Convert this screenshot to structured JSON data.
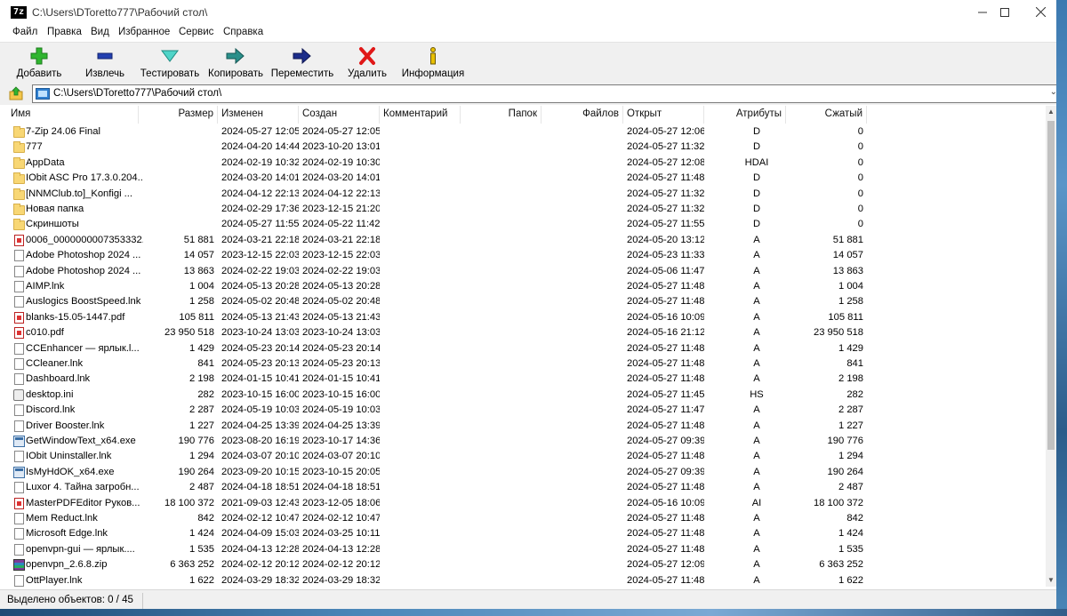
{
  "window": {
    "title": "C:\\Users\\DToretto777\\Рабочий стол\\",
    "app_icon_text": "7z"
  },
  "menu": [
    "Файл",
    "Правка",
    "Вид",
    "Избранное",
    "Сервис",
    "Справка"
  ],
  "toolbar": {
    "add": "Добавить",
    "extract": "Извлечь",
    "test": "Тестировать",
    "copy": "Копировать",
    "move": "Переместить",
    "delete": "Удалить",
    "info": "Информация"
  },
  "address": {
    "path": "C:\\Users\\DToretto777\\Рабочий стол\\"
  },
  "columns": {
    "name": "Имя",
    "size": "Размер",
    "modified": "Изменен",
    "created": "Создан",
    "comment": "Комментарий",
    "folders": "Папок",
    "files": "Файлов",
    "opened": "Открыт",
    "attributes": "Атрибуты",
    "packed": "Сжатый"
  },
  "rows": [
    {
      "icon": "folder",
      "name": "7-Zip 24.06 Final",
      "size": "",
      "modified": "2024-05-27 12:05",
      "created": "2024-05-27 12:05",
      "opened": "2024-05-27 12:06",
      "attr": "D",
      "packed": "0"
    },
    {
      "icon": "folder",
      "name": "777",
      "size": "",
      "modified": "2024-04-20 14:44",
      "created": "2023-10-20 13:01",
      "opened": "2024-05-27 11:32",
      "attr": "D",
      "packed": "0"
    },
    {
      "icon": "folder",
      "name": "AppData",
      "size": "",
      "modified": "2024-02-19 10:32",
      "created": "2024-02-19 10:30",
      "opened": "2024-05-27 12:08",
      "attr": "HDAI",
      "packed": "0"
    },
    {
      "icon": "folder",
      "name": "IObit ASC Pro 17.3.0.204...",
      "size": "",
      "modified": "2024-03-20 14:01",
      "created": "2024-03-20 14:01",
      "opened": "2024-05-27 11:48",
      "attr": "D",
      "packed": "0"
    },
    {
      "icon": "folder",
      "name": "[NNMClub.to]_Konfigi ...",
      "size": "",
      "modified": "2024-04-12 22:13",
      "created": "2024-04-12 22:13",
      "opened": "2024-05-27 11:32",
      "attr": "D",
      "packed": "0"
    },
    {
      "icon": "folder",
      "name": "Новая папка",
      "size": "",
      "modified": "2024-02-29 17:36",
      "created": "2023-12-15 21:20",
      "opened": "2024-05-27 11:32",
      "attr": "D",
      "packed": "0"
    },
    {
      "icon": "folder",
      "name": "Скриншоты",
      "size": "",
      "modified": "2024-05-27 11:55",
      "created": "2024-05-22 11:42",
      "opened": "2024-05-27 11:55",
      "attr": "D",
      "packed": "0"
    },
    {
      "icon": "pdf",
      "name": "0006_0000000007353332...",
      "size": "51 881",
      "modified": "2024-03-21 22:18",
      "created": "2024-03-21 22:18",
      "opened": "2024-05-20 13:12",
      "attr": "A",
      "packed": "51 881"
    },
    {
      "icon": "file",
      "name": "Adobe Photoshop 2024 ...",
      "size": "14 057",
      "modified": "2023-12-15 22:03",
      "created": "2023-12-15 22:03",
      "opened": "2024-05-23 11:33",
      "attr": "A",
      "packed": "14 057"
    },
    {
      "icon": "file",
      "name": "Adobe Photoshop 2024 ...",
      "size": "13 863",
      "modified": "2024-02-22 19:03",
      "created": "2024-02-22 19:03",
      "opened": "2024-05-06 11:47",
      "attr": "A",
      "packed": "13 863"
    },
    {
      "icon": "file",
      "name": "AIMP.lnk",
      "size": "1 004",
      "modified": "2024-05-13 20:28",
      "created": "2024-05-13 20:28",
      "opened": "2024-05-27 11:48",
      "attr": "A",
      "packed": "1 004"
    },
    {
      "icon": "file",
      "name": "Auslogics BoostSpeed.lnk",
      "size": "1 258",
      "modified": "2024-05-02 20:48",
      "created": "2024-05-02 20:48",
      "opened": "2024-05-27 11:48",
      "attr": "A",
      "packed": "1 258"
    },
    {
      "icon": "pdf",
      "name": "blanks-15.05-1447.pdf",
      "size": "105 811",
      "modified": "2024-05-13 21:43",
      "created": "2024-05-13 21:43",
      "opened": "2024-05-16 10:09",
      "attr": "A",
      "packed": "105 811"
    },
    {
      "icon": "pdf",
      "name": "c010.pdf",
      "size": "23 950 518",
      "modified": "2023-10-24 13:03",
      "created": "2023-10-24 13:03",
      "opened": "2024-05-16 21:12",
      "attr": "A",
      "packed": "23 950 518"
    },
    {
      "icon": "file",
      "name": "CCEnhancer — ярлык.l...",
      "size": "1 429",
      "modified": "2024-05-23 20:14",
      "created": "2024-05-23 20:14",
      "opened": "2024-05-27 11:48",
      "attr": "A",
      "packed": "1 429"
    },
    {
      "icon": "file",
      "name": "CCleaner.lnk",
      "size": "841",
      "modified": "2024-05-23 20:13",
      "created": "2024-05-23 20:13",
      "opened": "2024-05-27 11:48",
      "attr": "A",
      "packed": "841"
    },
    {
      "icon": "file",
      "name": "Dashboard.lnk",
      "size": "2 198",
      "modified": "2024-01-15 10:41",
      "created": "2024-01-15 10:41",
      "opened": "2024-05-27 11:48",
      "attr": "A",
      "packed": "2 198"
    },
    {
      "icon": "ini",
      "name": "desktop.ini",
      "size": "282",
      "modified": "2023-10-15 16:00",
      "created": "2023-10-15 16:00",
      "opened": "2024-05-27 11:45",
      "attr": "HS",
      "packed": "282"
    },
    {
      "icon": "file",
      "name": "Discord.lnk",
      "size": "2 287",
      "modified": "2024-05-19 10:03",
      "created": "2024-05-19 10:03",
      "opened": "2024-05-27 11:47",
      "attr": "A",
      "packed": "2 287"
    },
    {
      "icon": "file",
      "name": "Driver Booster.lnk",
      "size": "1 227",
      "modified": "2024-04-25 13:39",
      "created": "2024-04-25 13:39",
      "opened": "2024-05-27 11:48",
      "attr": "A",
      "packed": "1 227"
    },
    {
      "icon": "exe",
      "name": "GetWindowText_x64.exe",
      "size": "190 776",
      "modified": "2023-08-20 16:19",
      "created": "2023-10-17 14:36",
      "opened": "2024-05-27 09:39",
      "attr": "A",
      "packed": "190 776"
    },
    {
      "icon": "file",
      "name": "IObit Uninstaller.lnk",
      "size": "1 294",
      "modified": "2024-03-07 20:10",
      "created": "2024-03-07 20:10",
      "opened": "2024-05-27 11:48",
      "attr": "A",
      "packed": "1 294"
    },
    {
      "icon": "exe",
      "name": "IsMyHdOK_x64.exe",
      "size": "190 264",
      "modified": "2023-09-20 10:15",
      "created": "2023-10-15 20:05",
      "opened": "2024-05-27 09:39",
      "attr": "A",
      "packed": "190 264"
    },
    {
      "icon": "file",
      "name": "Luxor 4. Тайна загробн...",
      "size": "2 487",
      "modified": "2024-04-18 18:51",
      "created": "2024-04-18 18:51",
      "opened": "2024-05-27 11:48",
      "attr": "A",
      "packed": "2 487"
    },
    {
      "icon": "pdf",
      "name": "MasterPDFEditor Руков...",
      "size": "18 100 372",
      "modified": "2021-09-03 12:43",
      "created": "2023-12-05 18:06",
      "opened": "2024-05-16 10:09",
      "attr": "AI",
      "packed": "18 100 372"
    },
    {
      "icon": "file",
      "name": "Mem Reduct.lnk",
      "size": "842",
      "modified": "2024-02-12 10:47",
      "created": "2024-02-12 10:47",
      "opened": "2024-05-27 11:48",
      "attr": "A",
      "packed": "842"
    },
    {
      "icon": "file",
      "name": "Microsoft Edge.lnk",
      "size": "1 424",
      "modified": "2024-04-09 15:03",
      "created": "2024-03-25 10:11",
      "opened": "2024-05-27 11:48",
      "attr": "A",
      "packed": "1 424"
    },
    {
      "icon": "file",
      "name": "openvpn-gui — ярлык....",
      "size": "1 535",
      "modified": "2024-04-13 12:28",
      "created": "2024-04-13 12:28",
      "opened": "2024-05-27 11:48",
      "attr": "A",
      "packed": "1 535"
    },
    {
      "icon": "zip",
      "name": "openvpn_2.6.8.zip",
      "size": "6 363 252",
      "modified": "2024-02-12 20:12",
      "created": "2024-02-12 20:12",
      "opened": "2024-05-27 12:09",
      "attr": "A",
      "packed": "6 363 252"
    },
    {
      "icon": "file",
      "name": "OttPlayer.lnk",
      "size": "1 622",
      "modified": "2024-03-29 18:32",
      "created": "2024-03-29 18:32",
      "opened": "2024-05-27 11:48",
      "attr": "A",
      "packed": "1 622"
    }
  ],
  "status": {
    "selected": "Выделено объектов: 0 / 45"
  }
}
